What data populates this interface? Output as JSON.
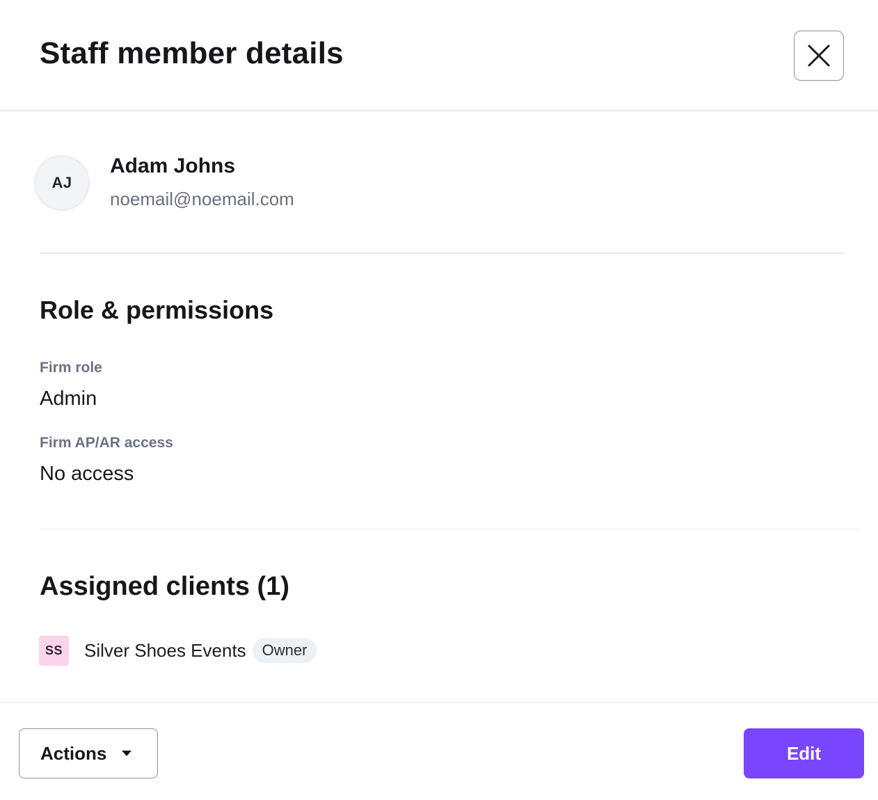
{
  "header": {
    "title": "Staff member details",
    "close_icon": "close-icon"
  },
  "profile": {
    "initials": "AJ",
    "name": "Adam Johns",
    "email": "noemail@noemail.com"
  },
  "role_permissions": {
    "title": "Role & permissions",
    "fields": [
      {
        "label": "Firm role",
        "value": "Admin"
      },
      {
        "label": "Firm AP/AR access",
        "value": "No access"
      }
    ]
  },
  "assigned_clients": {
    "title": "Assigned clients (1)",
    "clients": [
      {
        "initials": "SS",
        "name": "Silver Shoes Events",
        "role": "Owner",
        "badge_color": "#fbd3ea"
      }
    ]
  },
  "footer": {
    "actions_label": "Actions",
    "actions_icon": "caret-down-icon",
    "edit_label": "Edit",
    "accent_color": "#7a45ff"
  }
}
